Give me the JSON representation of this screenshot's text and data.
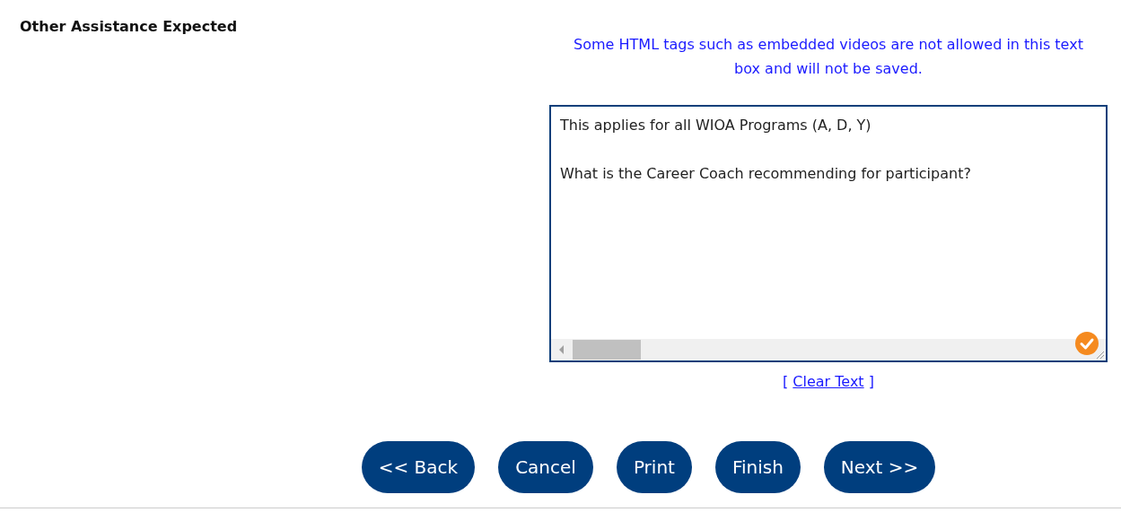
{
  "section_label": "Other Assistance Expected",
  "notice": "Some HTML tags such as embedded videos are not allowed in this text box and will not be saved.",
  "editor": {
    "lines": [
      "This applies for all WIOA Programs (A, D, Y)",
      "What is the Career Coach recommending for participant?"
    ],
    "validated": true
  },
  "clear_link": {
    "open": "[",
    "label": "Clear Text",
    "close": "]"
  },
  "buttons": [
    "<< Back",
    "Cancel",
    "Print",
    "Finish",
    "Next >>"
  ]
}
